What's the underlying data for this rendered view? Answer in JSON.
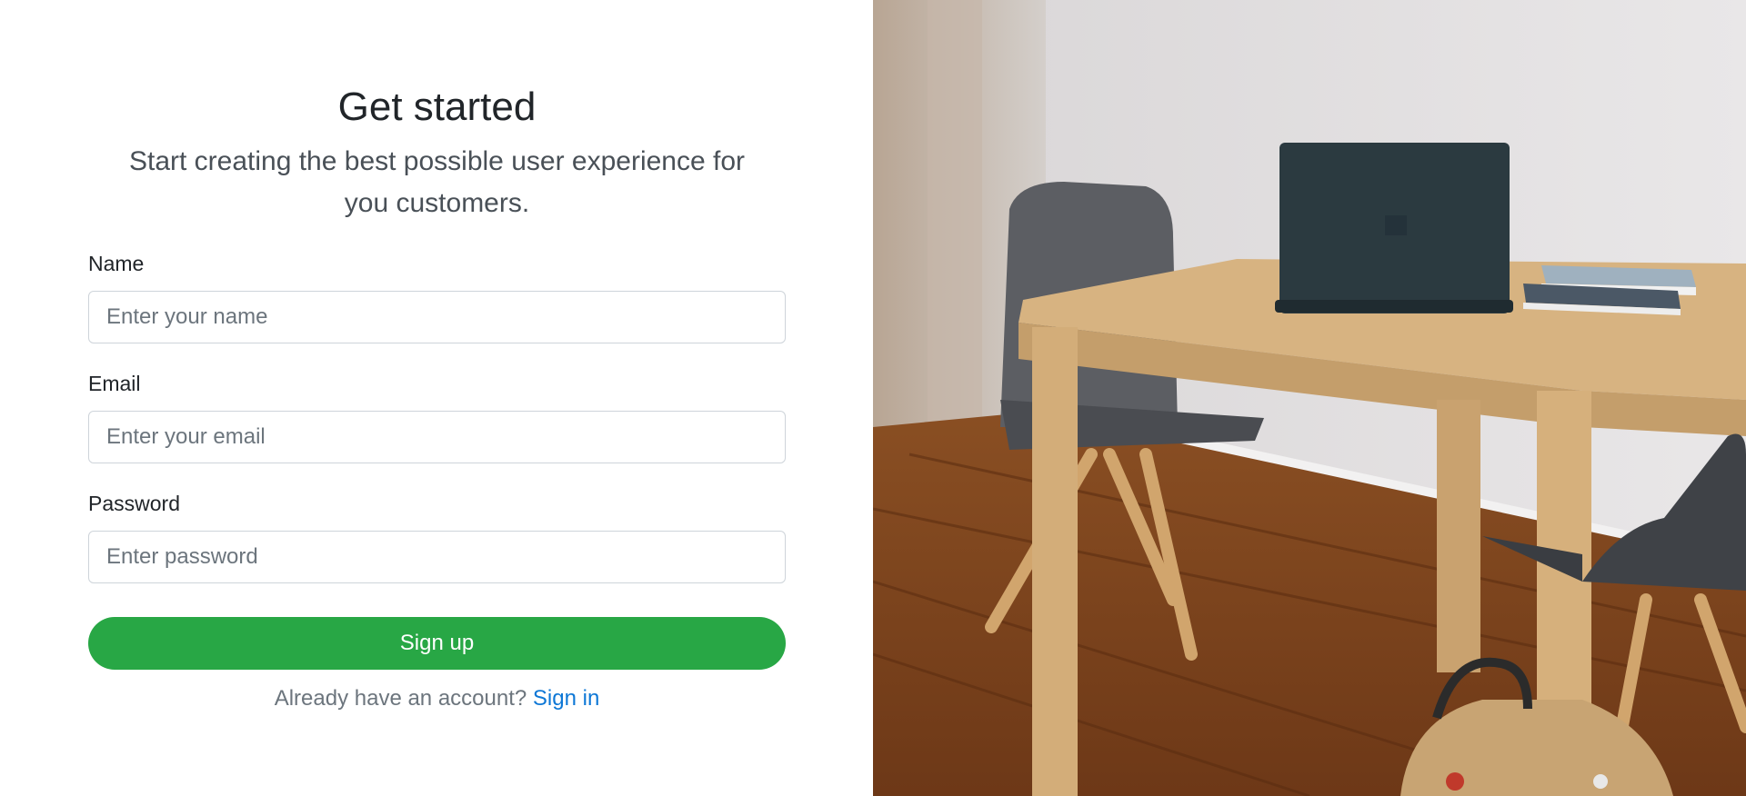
{
  "form": {
    "title": "Get started",
    "subtitle": "Start creating the best possible user experience for you customers.",
    "name_label": "Name",
    "name_placeholder": "Enter your name",
    "email_label": "Email",
    "email_placeholder": "Enter your email",
    "password_label": "Password",
    "password_placeholder": "Enter password",
    "submit_label": "Sign up",
    "signin_prompt": "Already have an account?",
    "signin_link": "Sign in"
  },
  "colors": {
    "primary_button": "#28a745",
    "link": "#0d77d6"
  },
  "image": {
    "subject": "room-photo"
  }
}
